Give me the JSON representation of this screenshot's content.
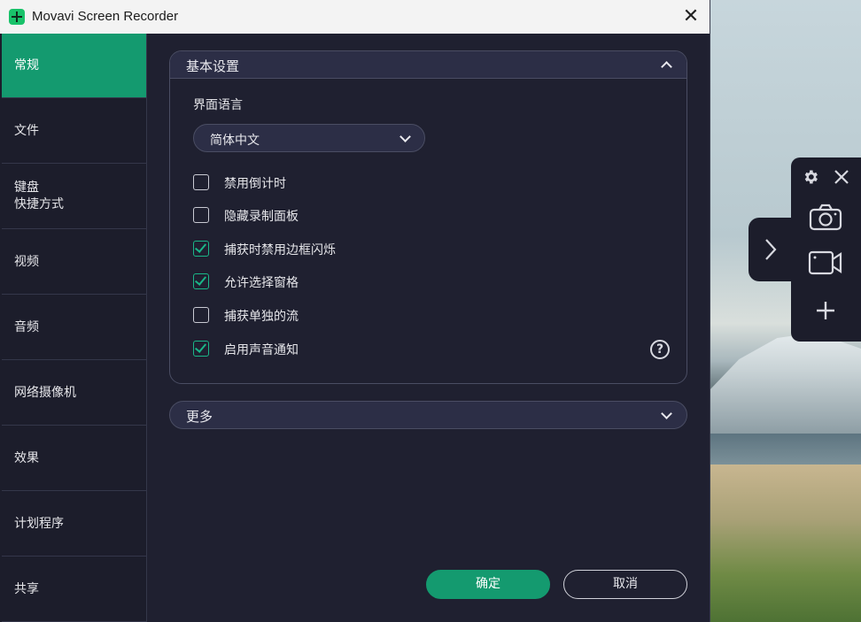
{
  "window": {
    "title": "Movavi Screen Recorder",
    "close_glyph": "✕"
  },
  "sidebar": {
    "items": [
      {
        "label": "常规",
        "active": true
      },
      {
        "label": "文件",
        "active": false
      },
      {
        "label": "键盘\n快捷方式",
        "active": false
      },
      {
        "label": "视频",
        "active": false
      },
      {
        "label": "音频",
        "active": false
      },
      {
        "label": "网络摄像机",
        "active": false
      },
      {
        "label": "效果",
        "active": false
      },
      {
        "label": "计划程序",
        "active": false
      },
      {
        "label": "共享",
        "active": false
      }
    ]
  },
  "basic": {
    "title": "基本设置",
    "language_label": "界面语言",
    "language_value": "简体中文",
    "options": [
      {
        "label": "禁用倒计时",
        "checked": false
      },
      {
        "label": "隐藏录制面板",
        "checked": false
      },
      {
        "label": "捕获时禁用边框闪烁",
        "checked": true
      },
      {
        "label": "允许选择窗格",
        "checked": true
      },
      {
        "label": "捕获单独的流",
        "checked": false
      },
      {
        "label": "启用声音通知",
        "checked": true
      }
    ],
    "help_glyph": "?"
  },
  "more": {
    "title": "更多"
  },
  "buttons": {
    "ok": "确定",
    "cancel": "取消"
  },
  "widget": {
    "icons": [
      "gear-icon",
      "close-icon",
      "camera-icon",
      "video-camera-icon",
      "plus-icon",
      "chevron-right-icon"
    ]
  },
  "colors": {
    "accent": "#149a6f",
    "background": "#1f2030",
    "panel_header": "#2c2e46"
  }
}
